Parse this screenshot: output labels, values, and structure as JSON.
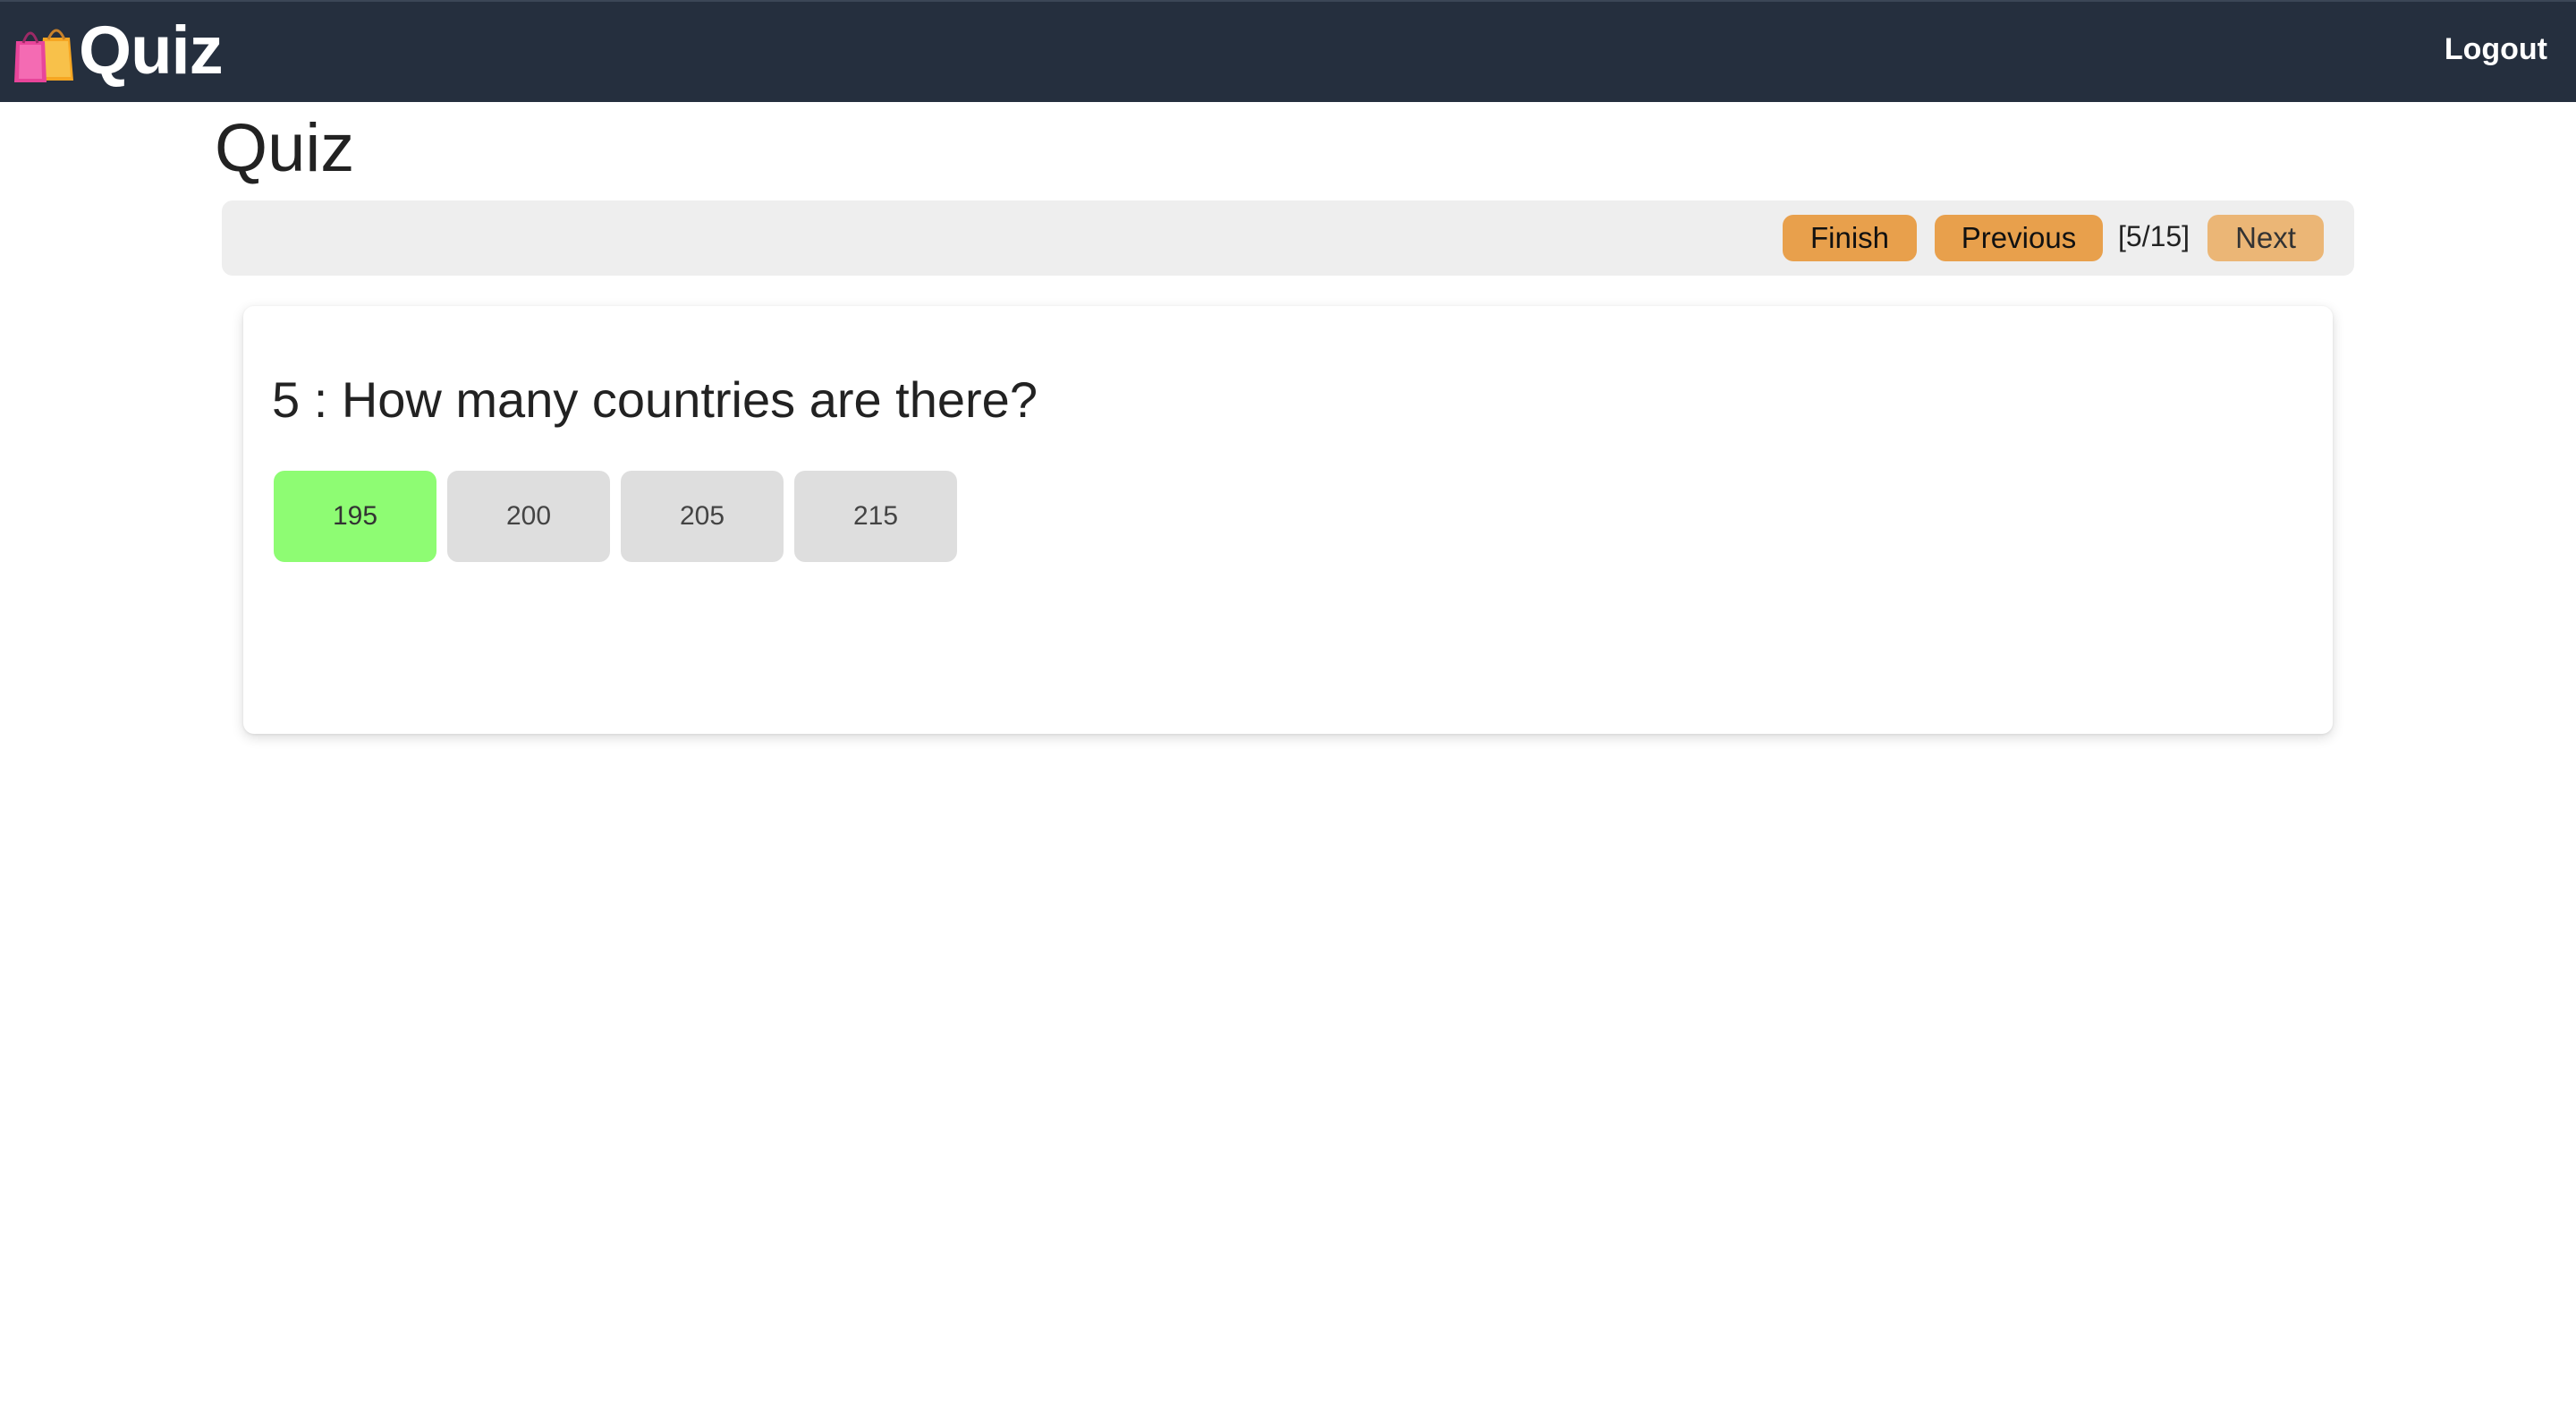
{
  "header": {
    "brand": "Quiz",
    "brand_icon": "shopping-bags-icon",
    "logout_label": "Logout"
  },
  "page": {
    "title": "Quiz"
  },
  "toolbar": {
    "finish_label": "Finish",
    "previous_label": "Previous",
    "counter": "[5/15]",
    "next_label": "Next",
    "accent_color": "#e8a04c"
  },
  "question": {
    "text": "5 : How many countries are there?",
    "answers": [
      {
        "label": "195",
        "selected": true
      },
      {
        "label": "200",
        "selected": false
      },
      {
        "label": "205",
        "selected": false
      },
      {
        "label": "215",
        "selected": false
      }
    ],
    "selected_color": "#8efc73"
  }
}
